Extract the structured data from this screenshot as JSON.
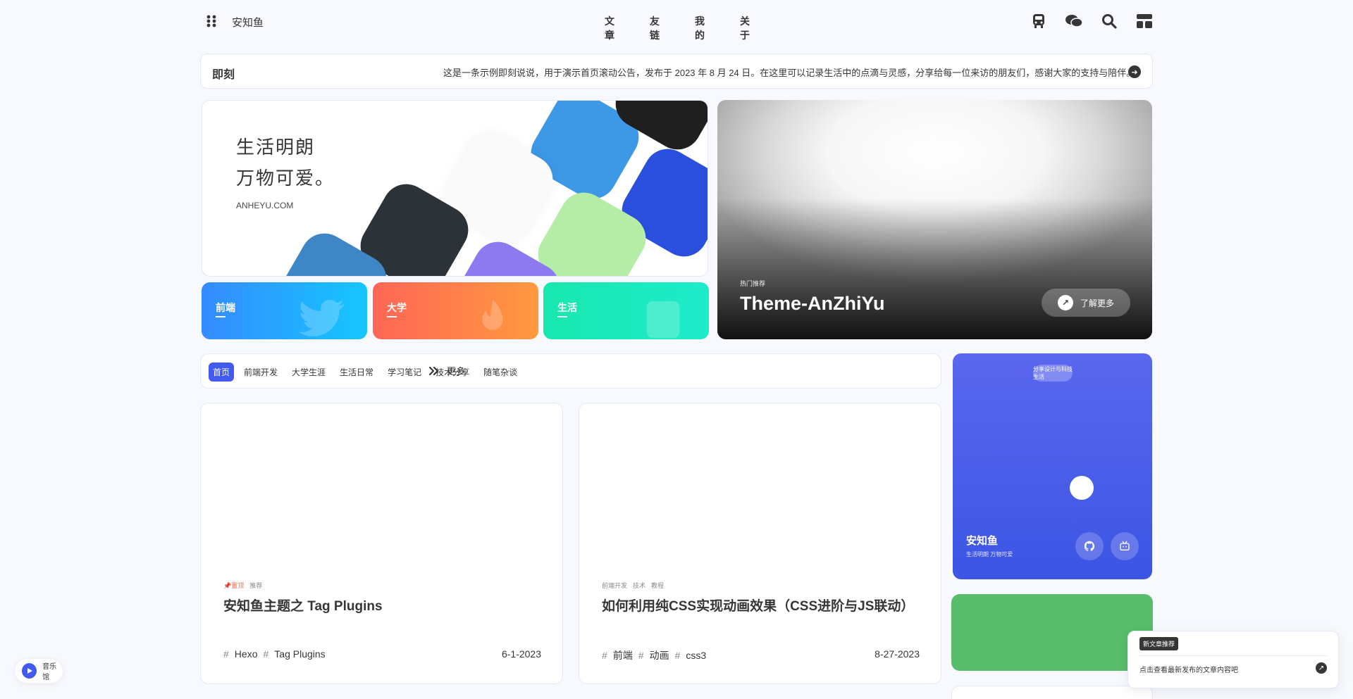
{
  "nav": {
    "site_name": "安知鱼",
    "menu_items": [
      "文 章",
      "友 链",
      "我 的",
      "关 于"
    ]
  },
  "bulletin": {
    "label": "即刻",
    "text": "这是一条示例即刻说说，用于演示首页滚动公告，发布于 2023 年 8 月 24 日。在这里可以记录生活中的点滴与灵感，分享给每一位来访的朋友们，感谢大家的支持与陪伴。"
  },
  "hero_left": {
    "title_line1": "生活明朗",
    "title_line2": "万物可爱。",
    "subtitle": "ANHEYU.COM"
  },
  "category_cards": [
    {
      "label": "前端",
      "color_from": "#358bff",
      "color_to": "#15c6ff"
    },
    {
      "label": "大学",
      "color_from": "#f65",
      "color_to": "#ff9a3e"
    },
    {
      "label": "生活",
      "color_from": "#18e7ae",
      "color_to": "#1eebeb"
    }
  ],
  "hero_right": {
    "tag": "热门推荐",
    "title": "Theme-AnZhiYu",
    "button_label": "了解更多"
  },
  "category_bar": {
    "items": [
      "首页",
      "前端开发",
      "大学生涯",
      "生活日常",
      "学习笔记",
      "技术分享",
      "随笔杂谈"
    ],
    "active_index": 0,
    "more_label": "更多"
  },
  "posts": [
    {
      "meta": [
        "置顶",
        "推荐"
      ],
      "pinned": true,
      "title": "安知鱼主题之 Tag Plugins",
      "tags": [
        "Hexo",
        "Tag Plugins"
      ],
      "date": "6-1-2023"
    },
    {
      "meta": [
        "前端开发",
        "技术",
        "教程"
      ],
      "pinned": false,
      "title": "如何利用纯CSS实现动画效果（CSS进阶与JS联动）",
      "tags": [
        "前端",
        "动画",
        "css3"
      ],
      "date": "8-27-2023"
    }
  ],
  "author": {
    "pill": "分享设计与科技生活",
    "name": "安知鱼",
    "desc": "生活明朗 万物可爱"
  },
  "notice": {
    "badge": "新文章推荐",
    "message": "点击查看最新发布的文章内容吧"
  },
  "music": {
    "label": "音乐馆"
  },
  "colors": {
    "accent": "#425aef",
    "green": "#57bd6a"
  }
}
